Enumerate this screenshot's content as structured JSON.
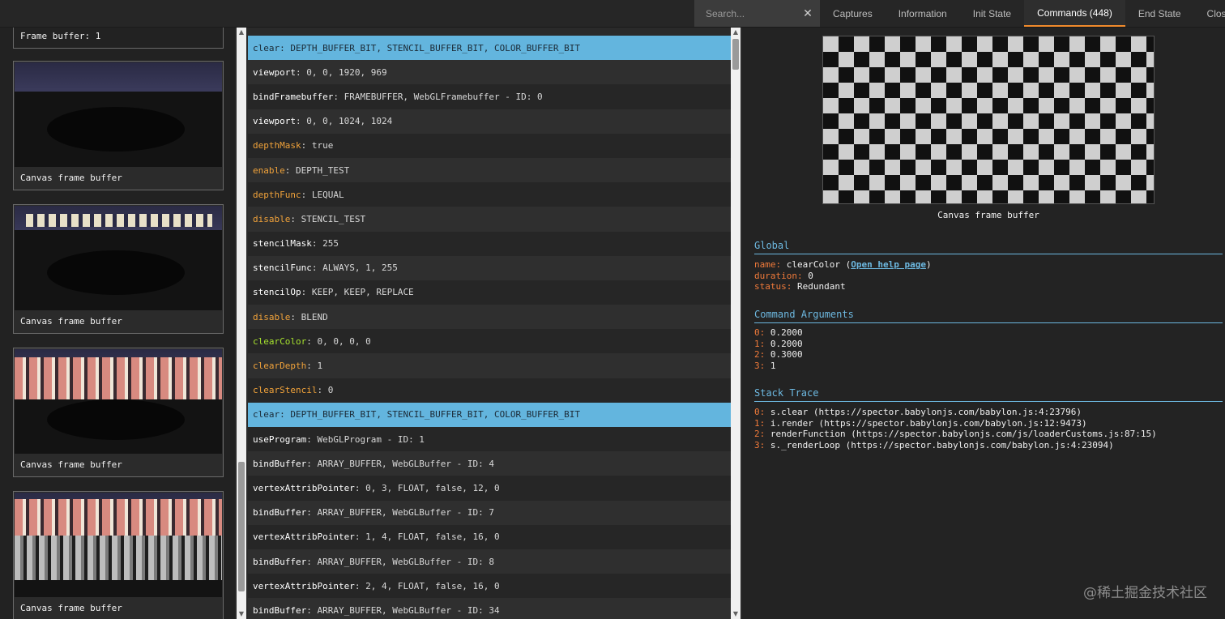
{
  "search": {
    "placeholder": "Search...",
    "clear_icon": "close-icon"
  },
  "tabs": [
    {
      "label": "Captures",
      "active": false
    },
    {
      "label": "Information",
      "active": false
    },
    {
      "label": "Init State",
      "active": false
    },
    {
      "label": "Commands (448)",
      "active": true
    },
    {
      "label": "End State",
      "active": false
    },
    {
      "label": "Close",
      "active": false
    }
  ],
  "left": {
    "top_label": "Frame buffer: 1",
    "cards": [
      {
        "caption": "Canvas frame buffer"
      },
      {
        "caption": "Canvas frame buffer"
      },
      {
        "caption": "Canvas frame buffer"
      },
      {
        "caption": "Canvas frame buffer"
      }
    ]
  },
  "commands": [
    {
      "name": "clear",
      "args": ": DEPTH_BUFFER_BIT, STENCIL_BUFFER_BIT, COLOR_BUFFER_BIT",
      "style": "sel"
    },
    {
      "name": "viewport",
      "args": ": 0, 0, 1920, 969",
      "style": ""
    },
    {
      "name": "bindFramebuffer",
      "args": ": FRAMEBUFFER, WebGLFramebuffer - ID: 0",
      "style": ""
    },
    {
      "name": "viewport",
      "args": ": 0, 0, 1024, 1024",
      "style": ""
    },
    {
      "name": "depthMask",
      "args": ": true",
      "style": "orange"
    },
    {
      "name": "enable",
      "args": ": DEPTH_TEST",
      "style": "orange"
    },
    {
      "name": "depthFunc",
      "args": ": LEQUAL",
      "style": "orange"
    },
    {
      "name": "disable",
      "args": ": STENCIL_TEST",
      "style": "orange"
    },
    {
      "name": "stencilMask",
      "args": ": 255",
      "style": ""
    },
    {
      "name": "stencilFunc",
      "args": ": ALWAYS, 1, 255",
      "style": ""
    },
    {
      "name": "stencilOp",
      "args": ": KEEP, KEEP, REPLACE",
      "style": ""
    },
    {
      "name": "disable",
      "args": ": BLEND",
      "style": "orange"
    },
    {
      "name": "clearColor",
      "args": ": 0, 0, 0, 0",
      "style": "green"
    },
    {
      "name": "clearDepth",
      "args": ": 1",
      "style": "orange"
    },
    {
      "name": "clearStencil",
      "args": ": 0",
      "style": "orange"
    },
    {
      "name": "clear",
      "args": ": DEPTH_BUFFER_BIT, STENCIL_BUFFER_BIT, COLOR_BUFFER_BIT",
      "style": "sel"
    },
    {
      "name": "useProgram",
      "args": ": WebGLProgram - ID: 1",
      "style": ""
    },
    {
      "name": "bindBuffer",
      "args": ": ARRAY_BUFFER, WebGLBuffer - ID: 4",
      "style": ""
    },
    {
      "name": "vertexAttribPointer",
      "args": ": 0, 3, FLOAT, false, 12, 0",
      "style": ""
    },
    {
      "name": "bindBuffer",
      "args": ": ARRAY_BUFFER, WebGLBuffer - ID: 7",
      "style": ""
    },
    {
      "name": "vertexAttribPointer",
      "args": ": 1, 4, FLOAT, false, 16, 0",
      "style": ""
    },
    {
      "name": "bindBuffer",
      "args": ": ARRAY_BUFFER, WebGLBuffer - ID: 8",
      "style": ""
    },
    {
      "name": "vertexAttribPointer",
      "args": ": 2, 4, FLOAT, false, 16, 0",
      "style": ""
    },
    {
      "name": "bindBuffer",
      "args": ": ARRAY_BUFFER, WebGLBuffer - ID: 34",
      "style": ""
    }
  ],
  "detail": {
    "preview_caption": "Canvas frame buffer",
    "global": {
      "title": "Global",
      "name_key": "name:",
      "name_val": "clearColor",
      "help_open": "(",
      "help_link": "Open help page",
      "help_close": ")",
      "duration_key": "duration:",
      "duration_val": "0",
      "status_key": "status:",
      "status_val": "Redundant"
    },
    "args": {
      "title": "Command Arguments",
      "items": [
        {
          "k": "0:",
          "v": "0.2000"
        },
        {
          "k": "1:",
          "v": "0.2000"
        },
        {
          "k": "2:",
          "v": "0.3000"
        },
        {
          "k": "3:",
          "v": "1"
        }
      ]
    },
    "stack": {
      "title": "Stack Trace",
      "items": [
        {
          "k": "0:",
          "v": "s.clear (https://spector.babylonjs.com/babylon.js:4:23796)"
        },
        {
          "k": "1:",
          "v": "i.render (https://spector.babylonjs.com/babylon.js:12:9473)"
        },
        {
          "k": "2:",
          "v": "renderFunction (https://spector.babylonjs.com/js/loaderCustoms.js:87:15)"
        },
        {
          "k": "3:",
          "v": "s._renderLoop (https://spector.babylonjs.com/babylon.js:4:23094)"
        }
      ]
    }
  },
  "watermark": "@稀土掘金技术社区",
  "colors": {
    "selected_row": "#63b5de",
    "orange_cmd": "#f0a23a",
    "green_cmd": "#a6e22e",
    "key": "#f07a3a",
    "section": "#6db8e0",
    "active_tab_underline": "#f08a2c"
  }
}
